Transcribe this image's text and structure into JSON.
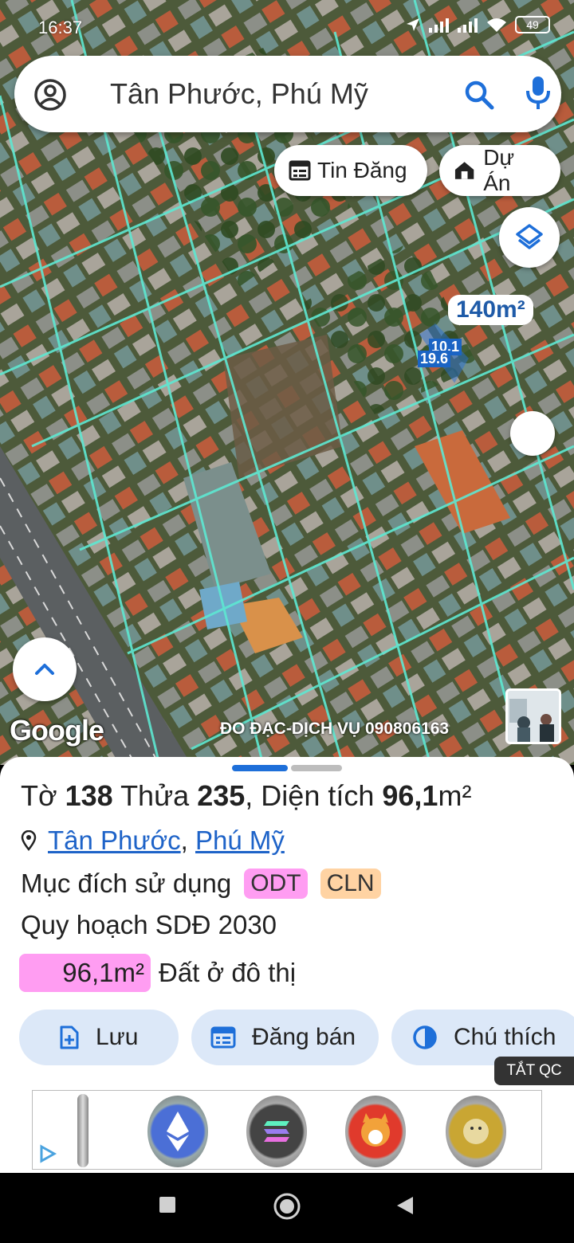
{
  "status_bar": {
    "time": "16:37",
    "battery": "49"
  },
  "search": {
    "query": "Tân Phước, Phú Mỹ"
  },
  "chips": {
    "listings": "Tin Đăng",
    "projects": "Dự Án"
  },
  "map": {
    "area_label": "140m²",
    "dimension_1": "10.1",
    "dimension_2": "19.6",
    "google": "Google",
    "watermark": "ĐO ĐẠC-DỊCH VỤ 090806163"
  },
  "parcel": {
    "sheet_label": "Tờ",
    "sheet_no": "138",
    "parcel_label": "Thửa",
    "parcel_no": "235",
    "area_label": ", Diện tích",
    "area_value": "96,1",
    "area_unit": "m²",
    "ward": "Tân Phước",
    "separator": ",",
    "town": "Phú Mỹ",
    "usage_label": "Mục đích sử dụng",
    "usage_codes": [
      "ODT",
      "CLN"
    ],
    "plan_label": "Quy hoạch SDĐ 2030",
    "plan_area": "96,1m²",
    "plan_type": "Đất ở đô thị"
  },
  "actions": {
    "save": "Lưu",
    "post": "Đăng bán",
    "legend": "Chú thích"
  },
  "ad": {
    "toggle": "TẮT QC"
  },
  "colors": {
    "accent": "#1e6fd9",
    "odt": "#ff9df2",
    "cln": "#ffd3a3",
    "button_bg": "#dce8f8",
    "parcel_lines": "#5ee8d2"
  }
}
